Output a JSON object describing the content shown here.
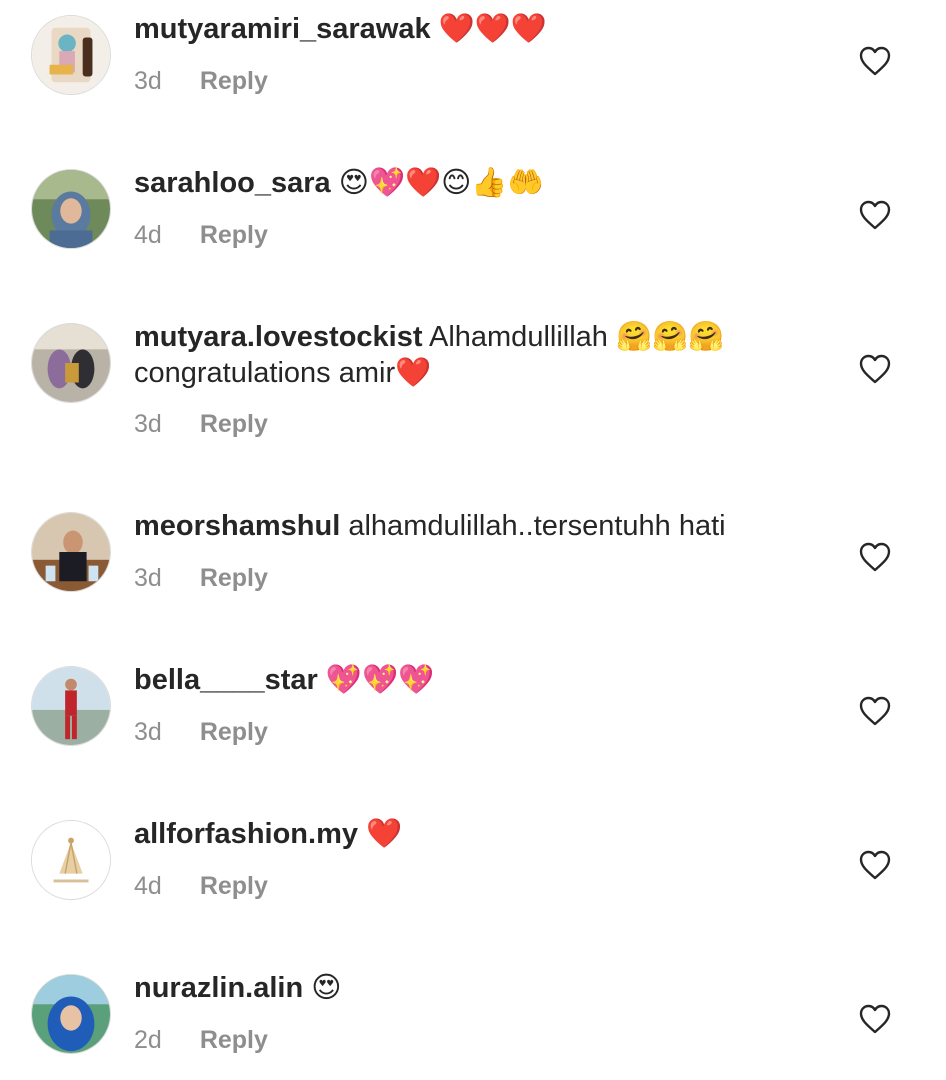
{
  "comments": [
    {
      "username": "mutyaramiri_sarawak",
      "text": "❤️❤️❤️",
      "age": "3d",
      "reply": "Reply"
    },
    {
      "username": "sarahloo_sara",
      "text": "😍💖❤️😊👍🤲",
      "age": "4d",
      "reply": "Reply"
    },
    {
      "username": "mutyara.lovestockist",
      "text": "Alhamdullillah 🤗🤗🤗 congratulations amir❤️",
      "age": "3d",
      "reply": "Reply"
    },
    {
      "username": "meorshamshul",
      "text": "alhamdulillah..tersentuhh hati",
      "age": "3d",
      "reply": "Reply"
    },
    {
      "username": "bella____star",
      "text": "💖💖💖",
      "age": "3d",
      "reply": "Reply"
    },
    {
      "username": "allforfashion.my",
      "text": "❤️",
      "age": "4d",
      "reply": "Reply"
    },
    {
      "username": "nurazlin.alin",
      "text": "😍",
      "age": "2d",
      "reply": "Reply"
    }
  ],
  "icons": {
    "like": "heart-outline-icon",
    "avatar": "profile-photo"
  },
  "colors": {
    "text": "#262626",
    "secondary": "#8e8e8e",
    "heart_stroke": "#262626"
  }
}
